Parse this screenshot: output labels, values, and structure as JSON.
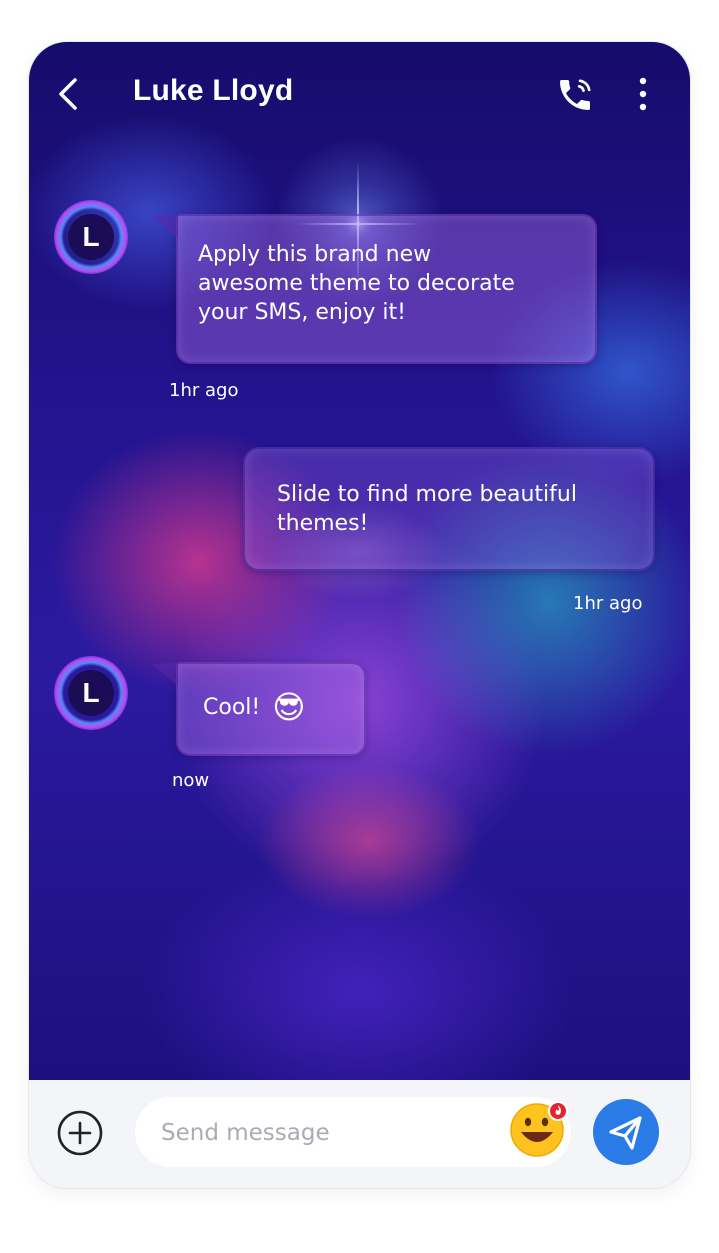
{
  "header": {
    "title": "Luke Lloyd",
    "back_icon": "chevron-left-icon",
    "call_icon": "phone-icon",
    "more_icon": "more-vertical-icon"
  },
  "messages": [
    {
      "direction": "incoming",
      "avatar_initial": "L",
      "lines": [
        "Apply this brand new",
        "awesome theme to decorate",
        "your SMS, enjoy it!"
      ],
      "timestamp": "1hr ago"
    },
    {
      "direction": "outgoing",
      "lines": [
        "Slide to find more beautiful",
        "themes!"
      ],
      "timestamp": "1hr ago"
    },
    {
      "direction": "incoming",
      "avatar_initial": "L",
      "text": "Cool!",
      "emoji": "😎",
      "timestamp": "now"
    }
  ],
  "composer": {
    "placeholder": "Send message",
    "add_icon": "plus-circle-icon",
    "emoji_icon": "emoji-face-icon",
    "send_icon": "send-icon"
  },
  "colors": {
    "accent": "#2b7be6",
    "composer_bg": "#f3f5f9"
  }
}
